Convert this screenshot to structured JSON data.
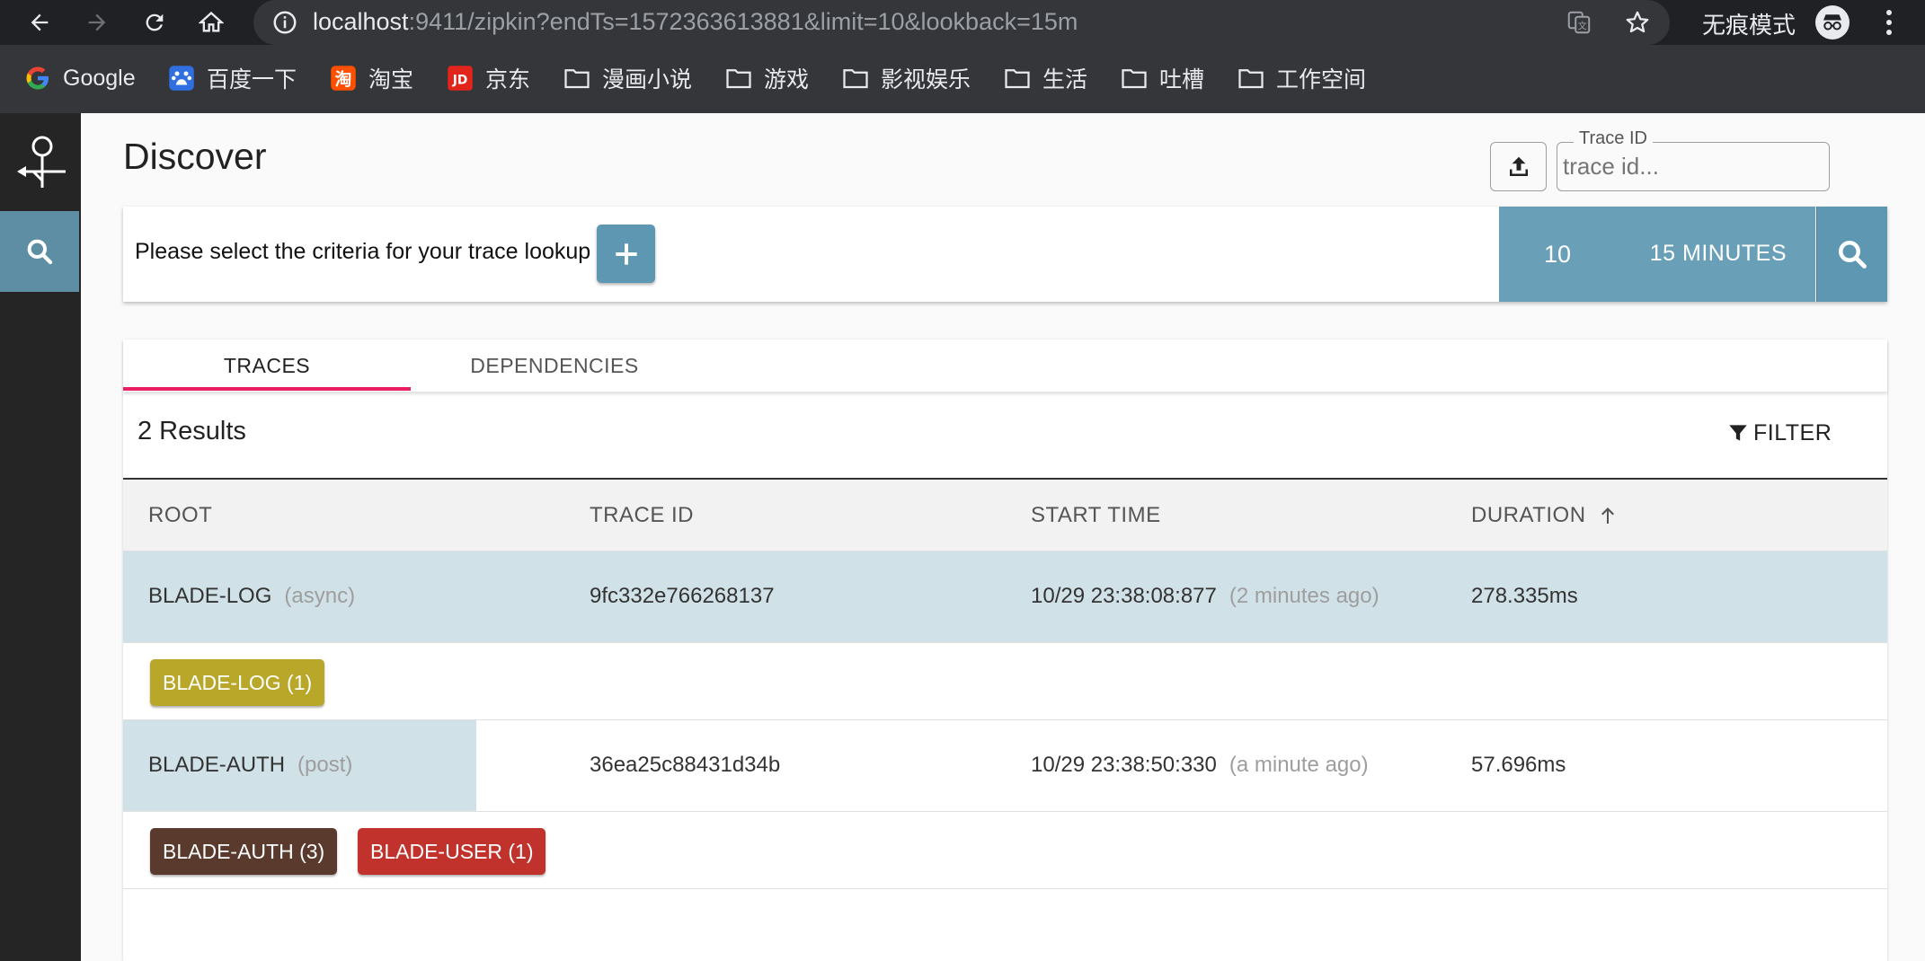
{
  "browser": {
    "url_host": "localhost",
    "url_rest": ":9411/zipkin?endTs=1572363613881&limit=10&lookback=15m",
    "incognito_label": "无痕模式",
    "bookmarks": [
      {
        "label": "Google",
        "icon": "google-icon"
      },
      {
        "label": "百度一下",
        "icon": "baidu-icon"
      },
      {
        "label": "淘宝",
        "icon": "taobao-icon"
      },
      {
        "label": "京东",
        "icon": "jd-icon"
      },
      {
        "label": "漫画小说",
        "icon": "folder-icon"
      },
      {
        "label": "游戏",
        "icon": "folder-icon"
      },
      {
        "label": "影视娱乐",
        "icon": "folder-icon"
      },
      {
        "label": "生活",
        "icon": "folder-icon"
      },
      {
        "label": "吐槽",
        "icon": "folder-icon"
      },
      {
        "label": "工作空间",
        "icon": "folder-icon"
      }
    ]
  },
  "app": {
    "title": "Discover",
    "trace_id_label": "Trace ID",
    "trace_id_placeholder": "trace id...",
    "criteria_prompt": "Please select the criteria for your trace lookup",
    "limit": "10",
    "lookback": "15 MINUTES",
    "tabs": [
      {
        "label": "TRACES",
        "active": true
      },
      {
        "label": "DEPENDENCIES",
        "active": false
      }
    ],
    "results_count": "2 Results",
    "filter_label": "FILTER",
    "columns": [
      "ROOT",
      "TRACE ID",
      "START TIME",
      "DURATION"
    ],
    "rows": [
      {
        "root": "BLADE-LOG",
        "root_span": "(async)",
        "trace_id": "9fc332e766268137",
        "start_time": "10/29 23:38:08:877",
        "relative_time": "(2 minutes ago)",
        "duration": "278.335ms",
        "duration_fraction": 1.0,
        "tags": [
          {
            "label": "BLADE-LOG (1)",
            "color": "#b9a72a"
          }
        ]
      },
      {
        "root": "BLADE-AUTH",
        "root_span": "(post)",
        "trace_id": "36ea25c88431d34b",
        "start_time": "10/29 23:38:50:330",
        "relative_time": "(a minute ago)",
        "duration": "57.696ms",
        "duration_fraction": 0.2,
        "tags": [
          {
            "label": "BLADE-AUTH (3)",
            "color": "#5b3a2e"
          },
          {
            "label": "BLADE-USER (1)",
            "color": "#c0322b"
          }
        ]
      }
    ],
    "colors": {
      "accent": "#5e97b1",
      "tab_indicator": "#e91e63",
      "duration_bar": "#d0e1e8",
      "sidebar": "#252525"
    }
  }
}
